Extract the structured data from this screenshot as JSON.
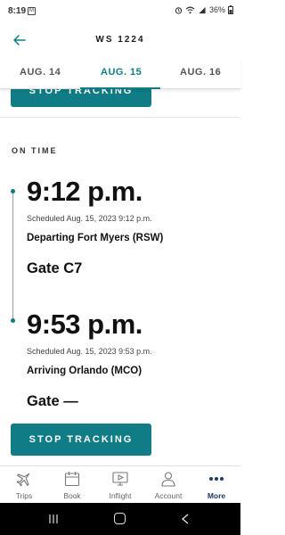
{
  "status_bar": {
    "time": "8:19",
    "battery": "36%"
  },
  "header": {
    "title": "WS 1224"
  },
  "tabs": [
    {
      "label": "AUG. 14"
    },
    {
      "label": "AUG. 15"
    },
    {
      "label": "AUG. 16"
    }
  ],
  "active_tab": "AUG. 15",
  "top_button": {
    "label": "STOP TRACKING"
  },
  "flight": {
    "status": "ON TIME",
    "departure": {
      "time": "9:12 p.m.",
      "scheduled": "Scheduled Aug. 15, 2023 9:12 p.m.",
      "city": "Departing Fort Myers (RSW)",
      "gate": "Gate C7"
    },
    "arrival": {
      "time": "9:53 p.m.",
      "scheduled": "Scheduled Aug. 15, 2023 9:53 p.m.",
      "city": "Arriving Orlando (MCO)",
      "gate": "Gate —"
    }
  },
  "stop_button": {
    "label": "STOP TRACKING"
  },
  "bottom_nav": [
    {
      "label": "Trips",
      "icon": "plane-icon"
    },
    {
      "label": "Book",
      "icon": "calendar-icon"
    },
    {
      "label": "Inflight",
      "icon": "inflight-screen-icon"
    },
    {
      "label": "Account",
      "icon": "person-icon"
    },
    {
      "label": "More",
      "icon": "more-dots-icon"
    }
  ],
  "colors": {
    "accent": "#0f7c86",
    "nav_active": "#1d3a6b"
  }
}
